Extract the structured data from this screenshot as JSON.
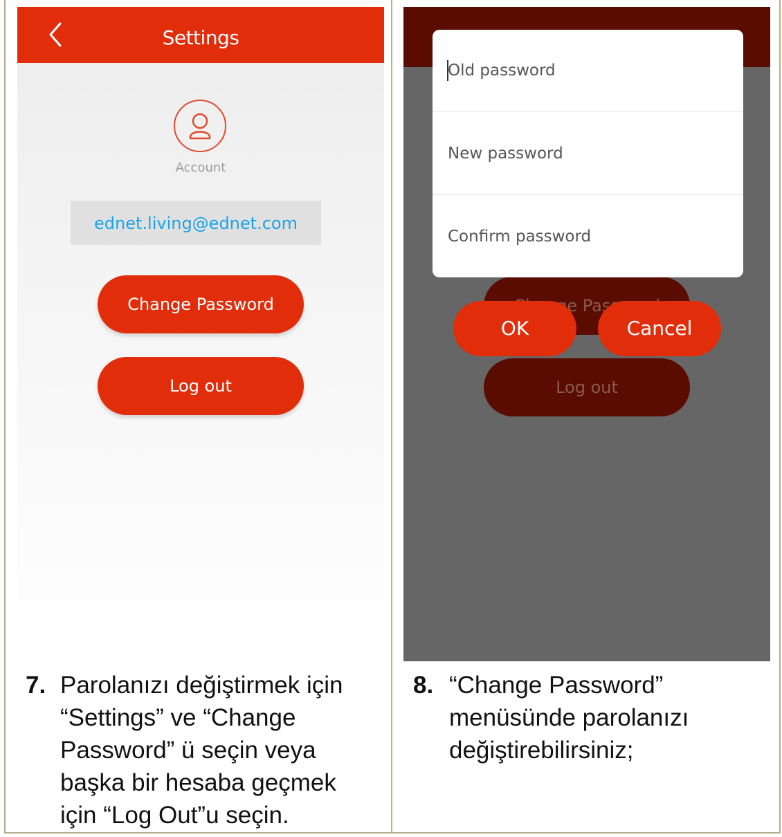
{
  "left_screen": {
    "header": {
      "title": "Settings",
      "back_icon": "chevron-left-icon"
    },
    "account": {
      "icon": "user-icon",
      "label": "Account",
      "email": "ednet.living@ednet.com"
    },
    "buttons": {
      "change_password": "Change Password",
      "logout": "Log out"
    },
    "colors": {
      "accent": "#e22d0b",
      "email": "#1aa3e8"
    }
  },
  "right_screen": {
    "dialog": {
      "old_password_placeholder": "Old password",
      "new_password_placeholder": "New password",
      "confirm_password_placeholder": "Confirm password"
    },
    "buttons": {
      "ok": "OK",
      "cancel": "Cancel"
    },
    "background_buttons": {
      "change_password": "Change Password",
      "logout": "Log out"
    },
    "colors": {
      "overlay": "#666666",
      "dim_accent": "#5a0c00"
    }
  },
  "captions": {
    "step7": {
      "number": "7.",
      "text": "Parolanızı değiştirmek için “Settings” ve “Change Password” ü seçin veya başka bir hesaba geçmek için “Log Out”u seçin."
    },
    "step8": {
      "number": "8.",
      "text": "“Change Password” menüsünde parolanızı değiştirebilirsiniz;"
    }
  }
}
